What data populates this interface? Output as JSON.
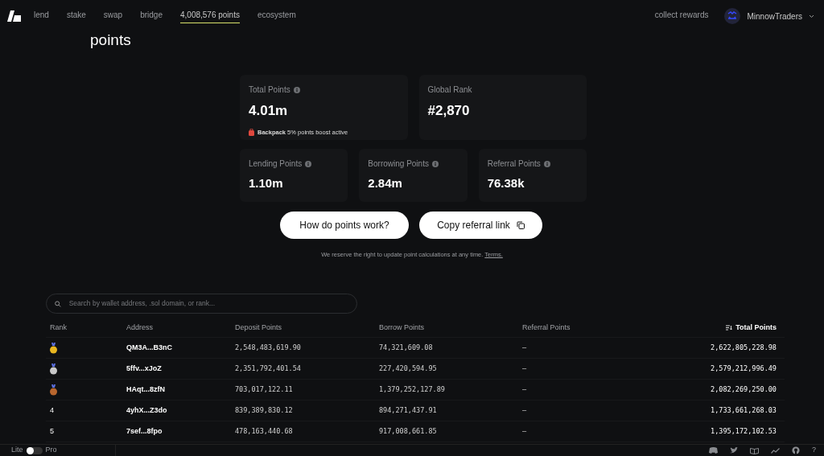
{
  "nav": {
    "items": [
      {
        "label": "lend",
        "selected": false
      },
      {
        "label": "stake",
        "selected": false
      },
      {
        "label": "swap",
        "selected": false
      },
      {
        "label": "bridge",
        "selected": false
      },
      {
        "label": "4,008,576 points",
        "selected": true
      },
      {
        "label": "ecosystem",
        "selected": false
      }
    ],
    "collect": "collect rewards",
    "account": "MinnowTraders"
  },
  "title": "points",
  "total": {
    "label": "Total Points",
    "value": "4.01m",
    "boost": "**Backpack** 5% points boost active"
  },
  "rank": {
    "label": "Global Rank",
    "value": "#2,870"
  },
  "stats": [
    {
      "label": "Lending Points",
      "value": "1.10m"
    },
    {
      "label": "Borrowing Points",
      "value": "2.84m"
    },
    {
      "label": "Referral Points",
      "value": "76.38k"
    }
  ],
  "buttons": {
    "how": "How do points work?",
    "copy": "Copy referral link"
  },
  "disclaimer": "We reserve the right to update point calculations at any time.",
  "terms": "Terms.",
  "search": {
    "placeholder": "Search by wallet address, .sol domain, or rank..."
  },
  "table": {
    "columns": [
      "Rank",
      "Address",
      "Deposit Points",
      "Borrow Points",
      "Referral Points",
      "Total Points"
    ],
    "rows": [
      {
        "kind": "medal",
        "color": "#e8b620",
        "address": "QM3A...B3nC",
        "deposit": "2,548,483,619.90",
        "borrow": "74,321,609.08",
        "referral": "–",
        "total": "2,622,805,228.98"
      },
      {
        "kind": "medal",
        "color": "#c9c9c9",
        "address": "5ffv...xJoZ",
        "deposit": "2,351,792,401.54",
        "borrow": "227,420,594.95",
        "referral": "–",
        "total": "2,579,212,996.49"
      },
      {
        "kind": "medal",
        "color": "#b8662e",
        "address": "HAqt...8zfN",
        "deposit": "703,017,122.11",
        "borrow": "1,379,252,127.89",
        "referral": "–",
        "total": "2,082,269,250.00"
      },
      {
        "kind": "number",
        "rank": "4",
        "address": "4yhX...Z3do",
        "deposit": "839,389,830.12",
        "borrow": "894,271,437.91",
        "referral": "–",
        "total": "1,733,661,268.03"
      },
      {
        "kind": "number",
        "rank": "5",
        "address": "7sef...8fpo",
        "deposit": "478,163,440.68",
        "borrow": "917,008,661.85",
        "referral": "–",
        "total": "1,395,172,102.53"
      }
    ]
  },
  "footer": {
    "lite": "Lite",
    "pro": "Pro",
    "pro_on": false,
    "help": "?"
  }
}
